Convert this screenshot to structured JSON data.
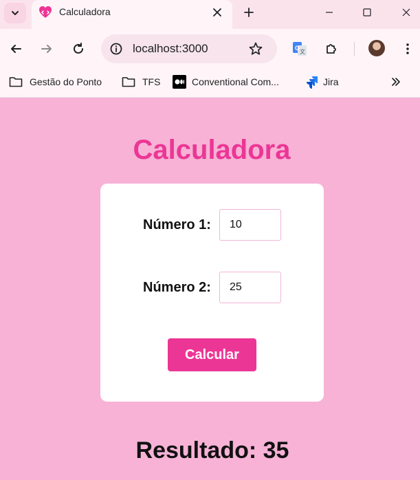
{
  "browser": {
    "tab": {
      "title": "Calculadora"
    },
    "address_bar": {
      "url": "localhost:3000"
    },
    "bookmarks": [
      {
        "label": "Gestão do Ponto",
        "icon": "folder-icon"
      },
      {
        "label": "TFS",
        "icon": "folder-icon"
      },
      {
        "label": "Conventional Com...",
        "icon": "medium-icon"
      },
      {
        "label": "Jira",
        "icon": "jira-icon"
      }
    ],
    "accent": "#ec3695"
  },
  "page": {
    "title": "Calculadora",
    "fields": [
      {
        "label": "Número 1:",
        "value": "10"
      },
      {
        "label": "Número 2:",
        "value": "25"
      }
    ],
    "button_label": "Calcular",
    "result": "Resultado: 35",
    "colors": {
      "background": "#f7b2d6",
      "title": "#ec3695",
      "button": "#ec3695",
      "card": "#ffffff"
    }
  }
}
